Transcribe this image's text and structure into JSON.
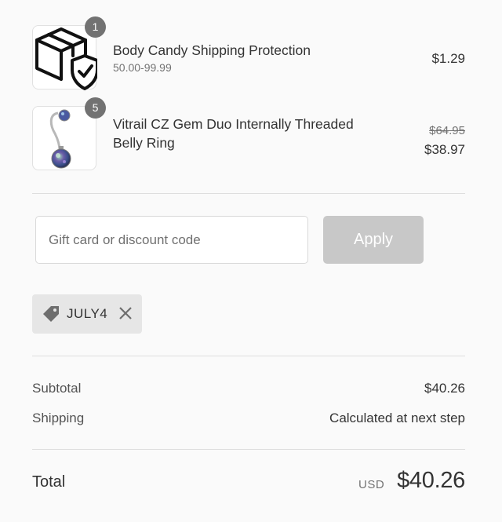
{
  "cart": {
    "items": [
      {
        "quantity": "1",
        "name": "Body Candy Shipping Protection",
        "variant": "50.00-99.99",
        "price": "$1.29",
        "icon": "shipping-protection-box-shield-icon"
      },
      {
        "quantity": "5",
        "name": "Vitrail CZ Gem Duo Internally Threaded Belly Ring",
        "original_price": "$64.95",
        "price": "$38.97",
        "icon": "belly-ring-product-image"
      }
    ]
  },
  "discount": {
    "placeholder": "Gift card or discount code",
    "value": "",
    "apply_label": "Apply",
    "applied_code": "JULY4",
    "applied_icon": "tag-icon",
    "remove_icon": "close-icon"
  },
  "summary": {
    "subtotal_label": "Subtotal",
    "subtotal_value": "$40.26",
    "shipping_label": "Shipping",
    "shipping_value": "Calculated at next step",
    "total_label": "Total",
    "currency": "USD",
    "total_value": "$40.26"
  },
  "colors": {
    "background": "#fafafa",
    "badge": "#727272",
    "apply_button_disabled": "#c8c8c8",
    "tag_background": "#e6e6e6",
    "divider": "#dedede"
  }
}
